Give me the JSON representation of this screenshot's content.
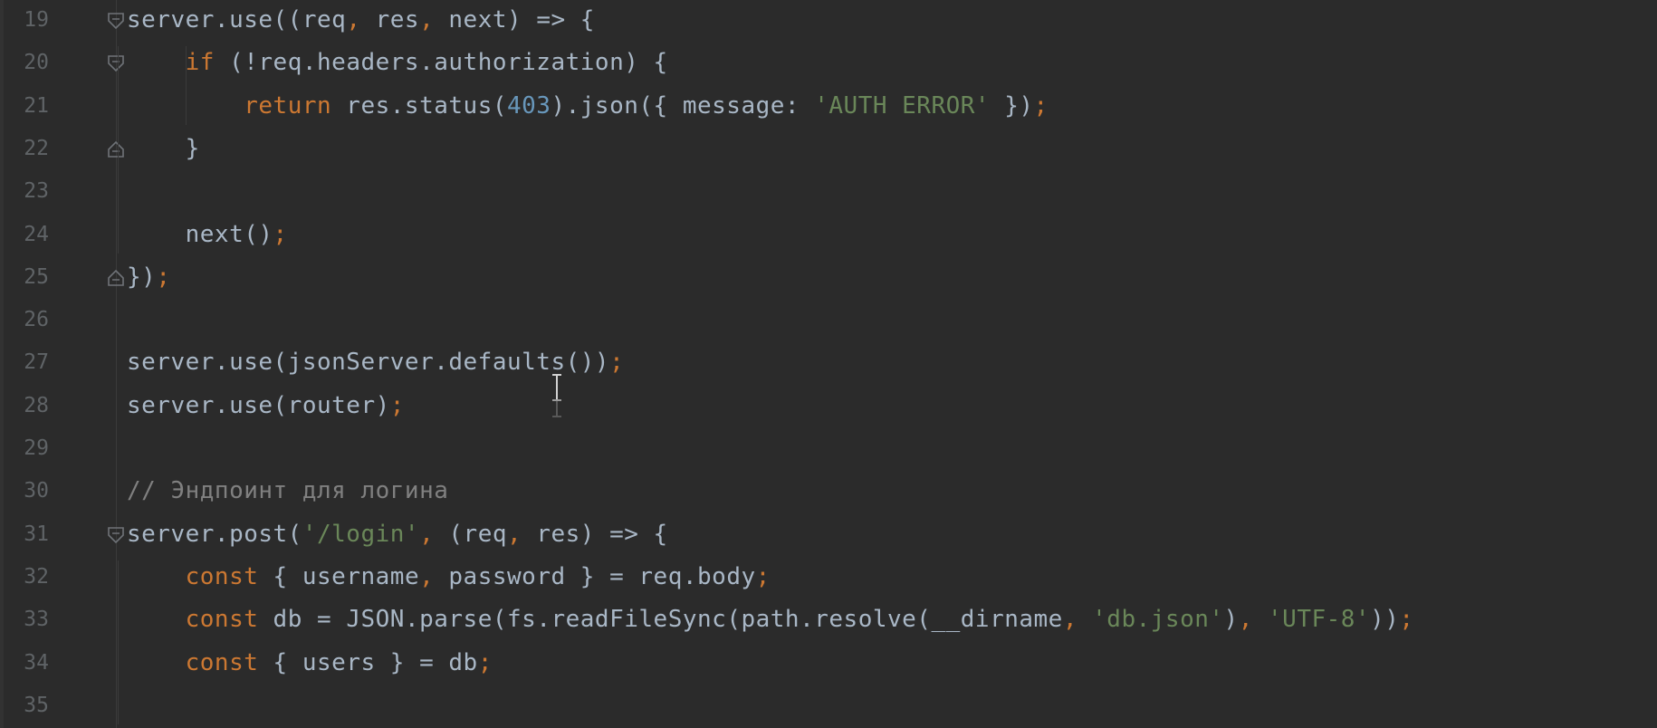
{
  "editor": {
    "lines": [
      {
        "n": "19",
        "fold": "open",
        "segs": [
          [
            "plain",
            "server.use((req"
          ],
          [
            "punct",
            ", "
          ],
          [
            "plain",
            "res"
          ],
          [
            "punct",
            ", "
          ],
          [
            "plain",
            "next) => {"
          ]
        ]
      },
      {
        "n": "20",
        "fold": "open",
        "segs": [
          [
            "plain",
            "    "
          ],
          [
            "kw",
            "if"
          ],
          [
            "plain",
            " (!req.headers.authorization) {"
          ]
        ]
      },
      {
        "n": "21",
        "fold": "",
        "segs": [
          [
            "plain",
            "        "
          ],
          [
            "kw",
            "return"
          ],
          [
            "plain",
            " res.status("
          ],
          [
            "num",
            "403"
          ],
          [
            "plain",
            ").json({ message: "
          ],
          [
            "str",
            "'AUTH ERROR'"
          ],
          [
            "plain",
            " })"
          ],
          [
            "punct",
            ";"
          ]
        ]
      },
      {
        "n": "22",
        "fold": "close",
        "segs": [
          [
            "plain",
            "    }"
          ]
        ]
      },
      {
        "n": "23",
        "fold": "",
        "segs": []
      },
      {
        "n": "24",
        "fold": "",
        "segs": [
          [
            "plain",
            "    next()"
          ],
          [
            "punct",
            ";"
          ]
        ]
      },
      {
        "n": "25",
        "fold": "close",
        "segs": [
          [
            "plain",
            "})"
          ],
          [
            "punct",
            ";"
          ]
        ]
      },
      {
        "n": "26",
        "fold": "",
        "segs": []
      },
      {
        "n": "27",
        "fold": "",
        "segs": [
          [
            "plain",
            "server.use(jsonServer.defaults())"
          ],
          [
            "punct",
            ";"
          ]
        ]
      },
      {
        "n": "28",
        "fold": "",
        "segs": [
          [
            "plain",
            "server.use(router)"
          ],
          [
            "punct",
            ";"
          ]
        ]
      },
      {
        "n": "29",
        "fold": "",
        "segs": []
      },
      {
        "n": "30",
        "fold": "",
        "segs": [
          [
            "cmt",
            "// Эндпоинт для логина"
          ]
        ]
      },
      {
        "n": "31",
        "fold": "open",
        "segs": [
          [
            "plain",
            "server.post("
          ],
          [
            "str",
            "'/login'"
          ],
          [
            "punct",
            ", "
          ],
          [
            "plain",
            "(req"
          ],
          [
            "punct",
            ", "
          ],
          [
            "plain",
            "res) => {"
          ]
        ]
      },
      {
        "n": "32",
        "fold": "",
        "segs": [
          [
            "plain",
            "    "
          ],
          [
            "kw",
            "const"
          ],
          [
            "plain",
            " { username"
          ],
          [
            "punct",
            ", "
          ],
          [
            "plain",
            "password } = req.body"
          ],
          [
            "punct",
            ";"
          ]
        ]
      },
      {
        "n": "33",
        "fold": "",
        "segs": [
          [
            "plain",
            "    "
          ],
          [
            "kw",
            "const"
          ],
          [
            "plain",
            " db = JSON.parse(fs.readFileSync(path.resolve(__dirname"
          ],
          [
            "punct",
            ", "
          ],
          [
            "str",
            "'db.json'"
          ],
          [
            "plain",
            ")"
          ],
          [
            "punct",
            ", "
          ],
          [
            "str",
            "'UTF-8'"
          ],
          [
            "plain",
            "))"
          ],
          [
            "punct",
            ";"
          ]
        ]
      },
      {
        "n": "34",
        "fold": "",
        "segs": [
          [
            "plain",
            "    "
          ],
          [
            "kw",
            "const"
          ],
          [
            "plain",
            " { users } = db"
          ],
          [
            "punct",
            ";"
          ]
        ]
      },
      {
        "n": "35",
        "fold": "",
        "segs": []
      }
    ]
  },
  "colors": {
    "background": "#2b2b2b",
    "keyword": "#cc7832",
    "string": "#6a8759",
    "number": "#6897bb",
    "comment": "#808080",
    "text": "#a9b7c6",
    "line_number": "#5f6366"
  },
  "icons": {
    "fold_open": "fold-open-icon",
    "fold_close": "fold-close-icon",
    "cursor": "text-cursor-icon"
  }
}
